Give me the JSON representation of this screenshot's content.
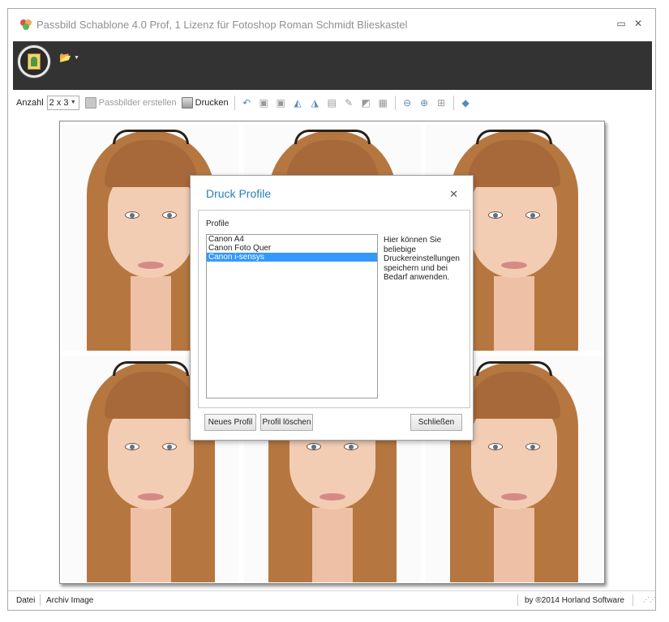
{
  "window": {
    "title": "Passbild Schablone 4.0 Prof, 1 Lizenz für Fotoshop Roman Schmidt Blieskastel",
    "minimize_glyph": "▭",
    "close_glyph": "✕"
  },
  "ribbon": {
    "app_menu_icon": "passport-photo-icon",
    "open_icon": "folder-open-icon"
  },
  "toolbar": {
    "anzahl_label": "Anzahl",
    "anzahl_value": "2 x 3",
    "create_label": "Passbilder erstellen",
    "print_label": "Drucken",
    "icons": [
      "undo-icon",
      "image-icon",
      "image-gray-icon",
      "flip-horizontal-icon",
      "flip-vertical-icon",
      "crop-icon",
      "pen-icon",
      "eraser-icon",
      "photo-icon",
      "zoom-out-icon",
      "zoom-in-icon",
      "fit-icon",
      "info-icon"
    ]
  },
  "dialog": {
    "title": "Druck Profile",
    "section_label": "Profile",
    "profiles": [
      "Canon A4",
      "Canon Foto Quer",
      "Canon i-sensys"
    ],
    "selected_index": 2,
    "help_text": "Hier können Sie beliebige Druckereinstellungen speichern und bei Bedarf anwenden.",
    "new_button": "Neues Profil",
    "delete_button": "Profil löschen",
    "close_button": "Schließen"
  },
  "statusbar": {
    "file_label": "Datei",
    "archive_label": "Archiv Image",
    "copyright": "by ®2014 Horland Software"
  },
  "colors": {
    "ribbon_bg": "#333333",
    "dialog_title": "#2c7db5",
    "selection": "#3399ff"
  }
}
